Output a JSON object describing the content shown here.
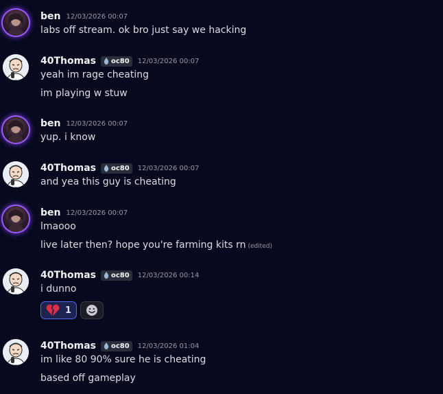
{
  "colors": {
    "background": "#070a1f",
    "username": "#f2f3f5",
    "timestamp": "#949ba4",
    "reaction_active_border": "#5865f2",
    "avatar_glow": "#9b5cf6"
  },
  "messages": [
    {
      "author": "ben",
      "avatar_icon": "ben-avatar-icon",
      "timestamp": "12/03/2026 00:07",
      "lines": [
        "labs off stream. ok bro just say we hacking"
      ]
    },
    {
      "author": "40Thomas",
      "avatar_icon": "thomas-avatar-icon",
      "tag": "oc80",
      "tag_icon": "water-drop-icon",
      "timestamp": "12/03/2026 00:07",
      "lines": [
        "yeah im rage cheating",
        "im playing w stuw"
      ]
    },
    {
      "author": "ben",
      "avatar_icon": "ben-avatar-icon",
      "timestamp": "12/03/2026 00:07",
      "lines": [
        "yup. i know"
      ]
    },
    {
      "author": "40Thomas",
      "avatar_icon": "thomas-avatar-icon",
      "tag": "oc80",
      "tag_icon": "water-drop-icon",
      "timestamp": "12/03/2026 00:07",
      "lines": [
        "and yea this guy is cheating"
      ]
    },
    {
      "author": "ben",
      "avatar_icon": "ben-avatar-icon",
      "timestamp": "12/03/2026 00:07",
      "lines": [
        "lmaooo",
        "live later then? hope you're farming kits rn"
      ],
      "edited_label": "(edited)"
    },
    {
      "author": "40Thomas",
      "avatar_icon": "thomas-avatar-icon",
      "tag": "oc80",
      "tag_icon": "water-drop-icon",
      "timestamp": "12/03/2026 00:14",
      "lines": [
        "i dunno"
      ],
      "reaction": {
        "icon": "broken-heart-icon",
        "count": "1"
      },
      "add_reaction_icon": "add-reaction-icon"
    },
    {
      "author": "40Thomas",
      "avatar_icon": "thomas-avatar-icon",
      "tag": "oc80",
      "tag_icon": "water-drop-icon",
      "timestamp": "12/03/2026 01:04",
      "lines": [
        "im like 80 90% sure he is cheating",
        "based off gameplay"
      ]
    }
  ]
}
